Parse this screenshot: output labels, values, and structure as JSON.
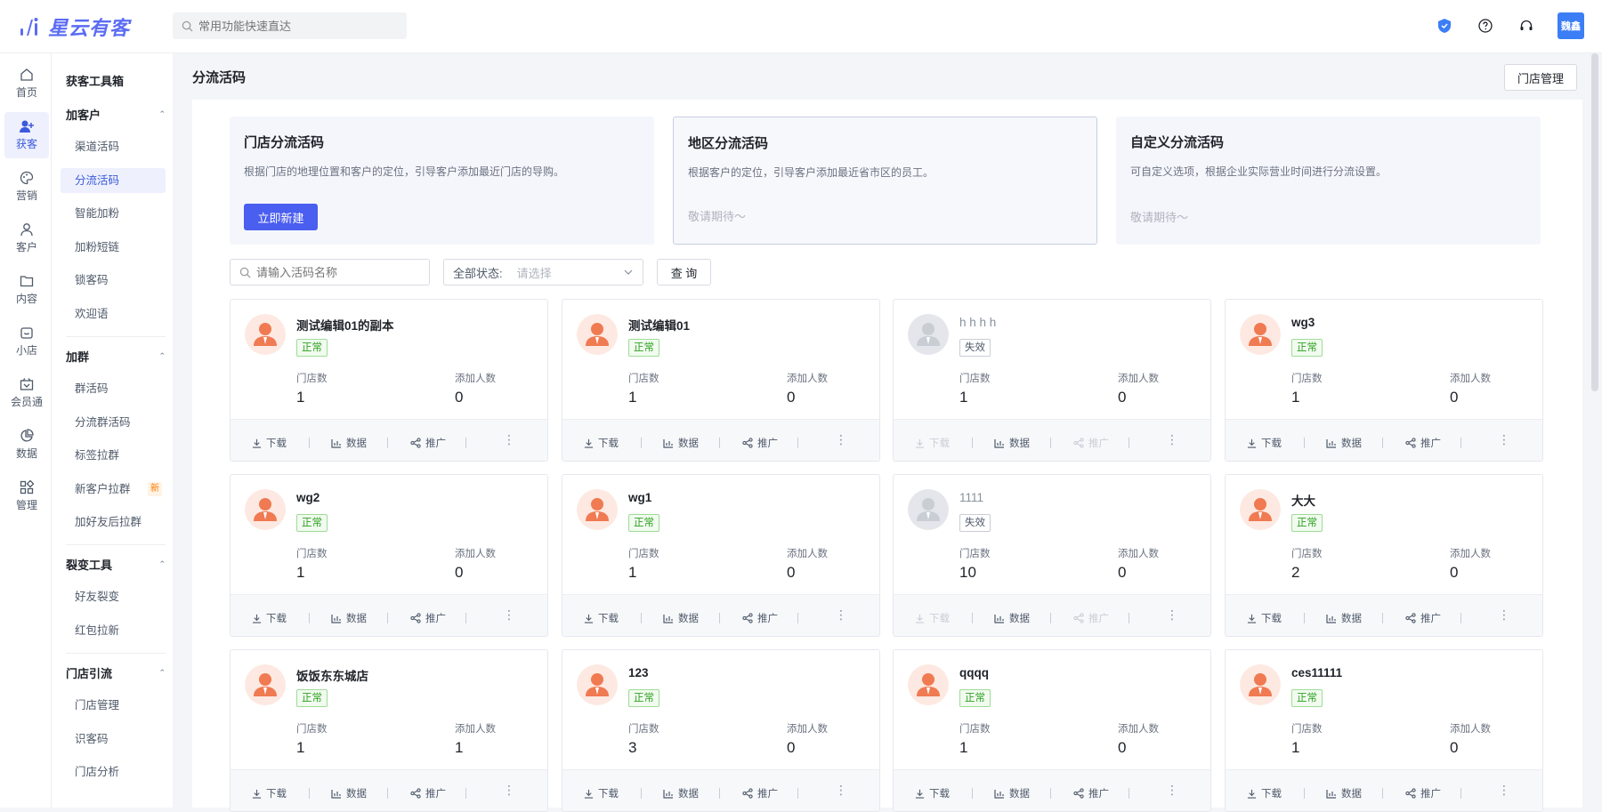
{
  "app": {
    "name": "星云有客"
  },
  "search": {
    "placeholder": "常用功能快速直达"
  },
  "user": {
    "avatar_text": "魏鑫"
  },
  "rail": [
    {
      "label": "首页",
      "icon": "home-icon"
    },
    {
      "label": "获客",
      "icon": "user-add-icon",
      "active": true
    },
    {
      "label": "营销",
      "icon": "palette-icon"
    },
    {
      "label": "客户",
      "icon": "person-icon"
    },
    {
      "label": "内容",
      "icon": "folder-icon"
    },
    {
      "label": "小店",
      "icon": "shop-icon"
    },
    {
      "label": "会员通",
      "icon": "vip-icon"
    },
    {
      "label": "数据",
      "icon": "pie-chart-icon"
    },
    {
      "label": "管理",
      "icon": "grid-icon"
    }
  ],
  "subnav": {
    "title": "获客工具箱",
    "groups": [
      {
        "label": "加客户",
        "items": [
          "渠道活码",
          "分流活码",
          "智能加粉",
          "加粉短链",
          "锁客码",
          "欢迎语"
        ]
      },
      {
        "label": "加群",
        "items": [
          "群活码",
          "分流群活码",
          "标签拉群",
          "新客户拉群",
          "加好友后拉群"
        ]
      },
      {
        "label": "裂变工具",
        "items": [
          "好友裂变",
          "红包拉新"
        ]
      },
      {
        "label": "门店引流",
        "items": [
          "门店管理",
          "识客码",
          "门店分析"
        ]
      }
    ],
    "new_badge": "新"
  },
  "page": {
    "title": "分流活码",
    "store_button": "门店管理"
  },
  "type_cards": [
    {
      "title": "门店分流活码",
      "desc": "根据门店的地理位置和客户的定位，引导客户添加最近门店的导购。",
      "action": "立即新建"
    },
    {
      "title": "地区分流活码",
      "desc": "根据客户的定位，引导客户添加最近省市区的员工。",
      "soon": "敬请期待～"
    },
    {
      "title": "自定义分流活码",
      "desc": "可自定义选项，根据企业实际营业时间进行分流设置。",
      "soon": "敬请期待～"
    }
  ],
  "filters": {
    "name_placeholder": "请输入活码名称",
    "status_label": "全部状态:",
    "status_placeholder": "请选择",
    "query_button": "查 询"
  },
  "card_labels": {
    "stores": "门店数",
    "added": "添加人数",
    "download": "下载",
    "data": "数据",
    "promote": "推广",
    "more": "⋮"
  },
  "cards": [
    {
      "name": "测试编辑01的副本",
      "status": "正常",
      "ok": true,
      "stores": "1",
      "added": "0"
    },
    {
      "name": "测试编辑01",
      "status": "正常",
      "ok": true,
      "stores": "1",
      "added": "0"
    },
    {
      "name": "h h h h",
      "status": "失效",
      "ok": false,
      "stores": "1",
      "added": "0"
    },
    {
      "name": "wg3",
      "status": "正常",
      "ok": true,
      "stores": "1",
      "added": "0"
    },
    {
      "name": "wg2",
      "status": "正常",
      "ok": true,
      "stores": "1",
      "added": "0"
    },
    {
      "name": "wg1",
      "status": "正常",
      "ok": true,
      "stores": "1",
      "added": "0"
    },
    {
      "name": "1111",
      "status": "失效",
      "ok": false,
      "stores": "10",
      "added": "0"
    },
    {
      "name": "大大",
      "status": "正常",
      "ok": true,
      "stores": "2",
      "added": "0"
    },
    {
      "name": "饭饭东东城店",
      "status": "正常",
      "ok": true,
      "stores": "1",
      "added": "1"
    },
    {
      "name": "123",
      "status": "正常",
      "ok": true,
      "stores": "3",
      "added": "0"
    },
    {
      "name": "qqqq",
      "status": "正常",
      "ok": true,
      "stores": "1",
      "added": "0"
    },
    {
      "name": "ces11111",
      "status": "正常",
      "ok": true,
      "stores": "1",
      "added": "0"
    }
  ],
  "colors": {
    "accent": "#4a5ef0",
    "ok": "#2ea121",
    "avatar": "#f07a52",
    "avatar_off": "#c9cdd4"
  }
}
